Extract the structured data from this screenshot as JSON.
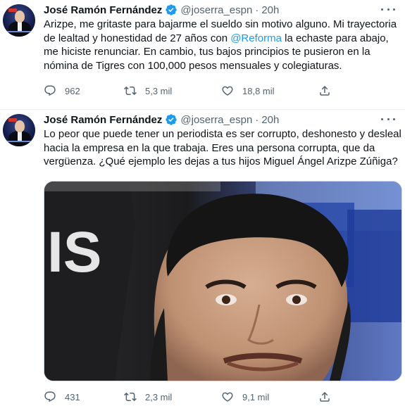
{
  "tweets": [
    {
      "author_name": "José Ramón Fernández",
      "handle": "@joserra_espn",
      "separator": "·",
      "time": "20h",
      "text_before": "Arizpe, me gritaste para bajarme el sueldo sin motivo alguno. Mi trayectoria de lealtad y honestidad de 27 años con ",
      "mention": "@Reforma",
      "text_after": " la echaste para abajo, me hiciste renunciar. En cambio, tus bajos principios te pusieron en la nómina de Tigres con 100,000 pesos mensuales y colegiaturas.",
      "replies": "962",
      "retweets": "5,3 mil",
      "likes": "18,8 mil"
    },
    {
      "author_name": "José Ramón Fernández",
      "handle": "@joserra_espn",
      "separator": "·",
      "time": "20h",
      "text": "Lo peor que puede tener un periodista es ser corrupto, deshonesto y desleal hacia la empresa en la que trabaja. Eres una persona corrupta, que da vergüenza. ¿Qué ejemplo les dejas a tus hijos Miguel Ángel Arizpe Zúñiga?",
      "photo_text": "IS",
      "replies": "431",
      "retweets": "2,3 mil",
      "likes": "9,1 mil"
    }
  ],
  "colors": {
    "text": "#0f1419",
    "secondary": "#536471",
    "link": "#1d9bf0",
    "verified": "#1d9bf0"
  },
  "icons": [
    "verified-badge-icon",
    "more-icon",
    "reply-icon",
    "retweet-icon",
    "like-icon",
    "share-icon"
  ]
}
